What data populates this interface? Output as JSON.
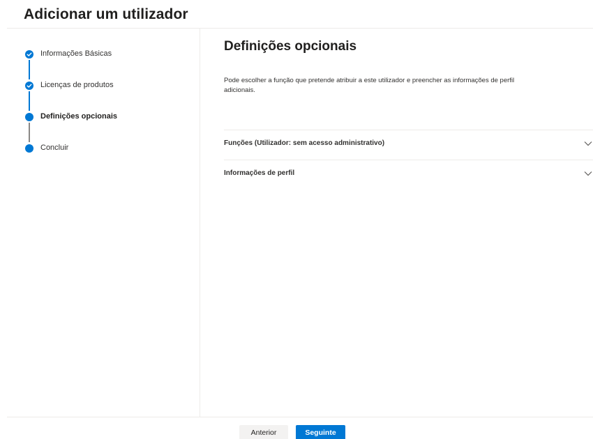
{
  "header": {
    "title": "Adicionar um utilizador"
  },
  "steps": [
    {
      "label": "Informações Básicas",
      "state": "completed"
    },
    {
      "label": "Licenças de produtos",
      "state": "completed"
    },
    {
      "label": "Definições opcionais",
      "state": "current"
    },
    {
      "label": "Concluir",
      "state": "pending"
    }
  ],
  "main": {
    "title": "Definições opcionais",
    "description": "Pode escolher a função que pretende atribuir a este utilizador e preencher as informações de perfil adicionais.",
    "sections": [
      {
        "label": "Funções (Utilizador: sem acesso administrativo)",
        "icon": "chevron-down-icon"
      },
      {
        "label": "Informações de perfil",
        "icon": "chevron-down-icon"
      }
    ]
  },
  "footer": {
    "back_label": "Anterior",
    "next_label": "Seguinte"
  },
  "colors": {
    "accent": "#0078d4",
    "divider": "#edebe9",
    "pending_line": "#8a8886"
  }
}
